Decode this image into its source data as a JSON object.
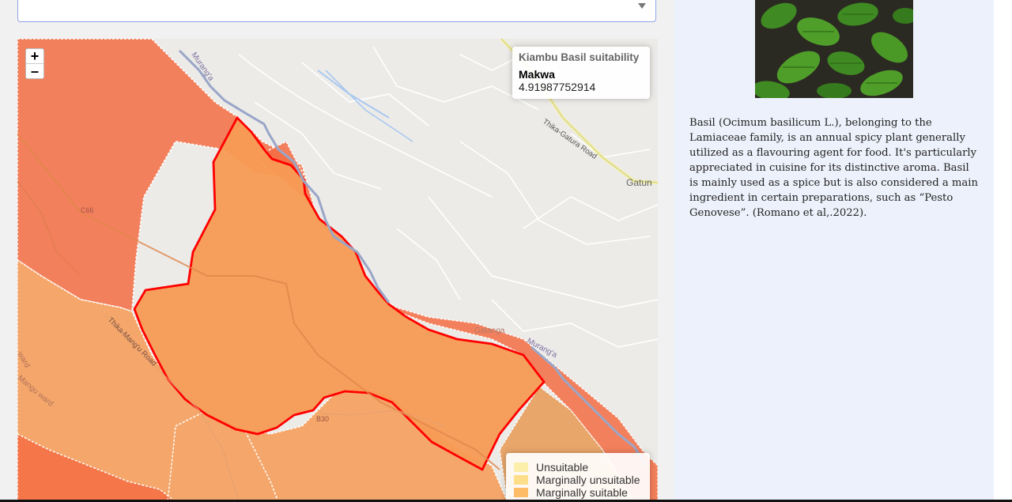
{
  "dropdown": {
    "selected": ""
  },
  "map": {
    "zoom_in": "+",
    "zoom_out": "–",
    "info": {
      "title": "Kiambu Basil suitability",
      "name": "Makwa",
      "value": "4.91987752914"
    },
    "legend": [
      {
        "label": "Unsuitable",
        "color": "#fcec9e"
      },
      {
        "label": "Marginally unsuitable",
        "color": "#fed976"
      },
      {
        "label": "Marginally suitable",
        "color": "#feb24c"
      }
    ],
    "place_labels": {
      "road1": "Thika-Gatura Road",
      "town": "Gatun",
      "road2": "Thika-Mang'u Road",
      "c66": "C66",
      "b30": "B30",
      "river1": "Murang'a",
      "river2": "Murang'a",
      "gatanga": "Gatanga",
      "ward": "Mangu ward",
      "ward2": "ward"
    },
    "colors": {
      "unsuitable_region": "#f46d43",
      "marginal_region": "#f79b55",
      "selected_region": "#f79b55",
      "highlight_border": "#ff0000"
    }
  },
  "side": {
    "image_alt": "basil-photo",
    "description": "Basil (Ocimum basilicum L.), belonging to the Lamiaceae family, is an annual spicy plant generally utilized as a flavouring agent for food. It's particularly appreciated in cuisine for its distinctive aroma. Basil is mainly used as a spice but is also considered a main ingredient in certain preparations, such as “Pesto Genovese”. (Romano et al,.2022)."
  }
}
